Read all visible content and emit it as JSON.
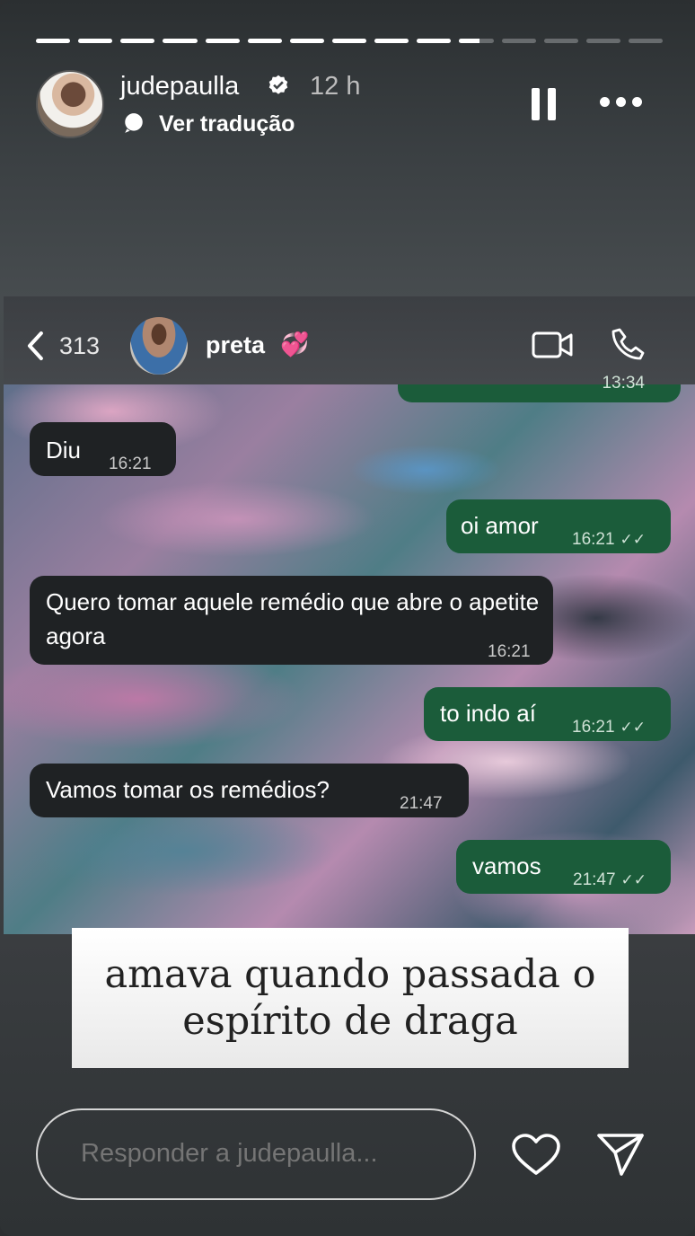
{
  "story": {
    "progress_segments_total": 15,
    "progress_segments_seen": 10,
    "current_segment_fraction": 0.6,
    "username": "judepaulla",
    "verified_icon": "verified-badge-icon",
    "time": "12 h",
    "translate_label": "Ver tradução"
  },
  "chat": {
    "back_count": "313",
    "contact_name": "preta",
    "contact_emoji": "💞",
    "partial_time": "13:34",
    "messages": [
      {
        "dir": "in",
        "text": "Diu",
        "time": "16:21"
      },
      {
        "dir": "out",
        "text": "oi amor",
        "time": "16:21"
      },
      {
        "dir": "in",
        "text": "Quero tomar aquele remédio que abre o apetite agora",
        "time": "16:21"
      },
      {
        "dir": "out",
        "text": "to indo aí",
        "time": "16:21"
      },
      {
        "dir": "in",
        "text": "Vamos tomar os remédios?",
        "time": "21:47"
      },
      {
        "dir": "out",
        "text": "vamos",
        "time": "21:47"
      }
    ]
  },
  "caption": {
    "line1": "amava quando passada o",
    "line2": "espírito de draga"
  },
  "reply": {
    "placeholder": "Responder a judepaulla..."
  },
  "colors": {
    "incoming_bubble": "#1f2224",
    "outgoing_bubble": "#1b5c3a"
  }
}
